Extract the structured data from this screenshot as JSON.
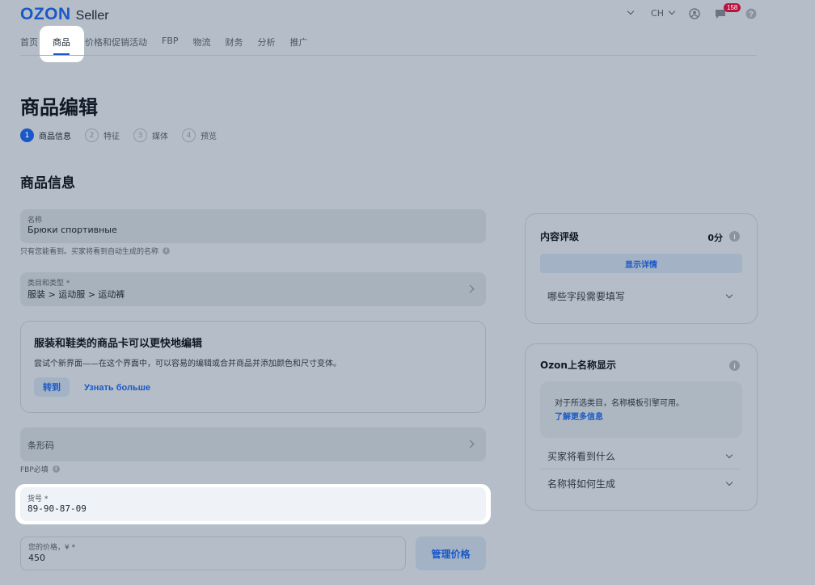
{
  "header": {
    "logo_brand": "OZON",
    "logo_product": "Seller",
    "language": "CH",
    "notifications_count": "158"
  },
  "nav": {
    "items": [
      "首页",
      "商品",
      "价格和促销活动",
      "FBP",
      "物流",
      "财务",
      "分析",
      "推广"
    ],
    "active_index": 1
  },
  "page": {
    "title": "商品编辑",
    "steps": [
      {
        "num": "1",
        "label": "商品信息"
      },
      {
        "num": "2",
        "label": "特征"
      },
      {
        "num": "3",
        "label": "媒体"
      },
      {
        "num": "4",
        "label": "预览"
      }
    ],
    "section_title": "商品信息"
  },
  "form": {
    "name": {
      "label": "名称",
      "value": "Брюки спортивные",
      "hint": "只有您能看到。买家将看到自动生成的名称"
    },
    "category": {
      "label": "类目和类型 *",
      "value": "服装 > 运动服 > 运动裤"
    },
    "promo": {
      "title": "服装和鞋类的商品卡可以更快地编辑",
      "text": "尝试个新界面——在这个界面中，可以容易的编辑或合并商品并添加颜色和尺寸变体。",
      "go_label": "转到",
      "more_label": "Узнать больше"
    },
    "barcode": {
      "label": "条形码",
      "hint": "FBP必填"
    },
    "sku": {
      "label": "货号 *",
      "value": "89-90-87-09"
    },
    "price": {
      "label": "您的价格，¥ *",
      "value": "450",
      "button_label": "管理价格"
    }
  },
  "sidebar": {
    "rating": {
      "title": "内容评级",
      "score": "0分",
      "details_label": "显示详情",
      "accordion_label": "哪些字段需要填写"
    },
    "naming": {
      "title": "Ozon上名称显示",
      "note_text": "对于所选类目，名称模板引擎可用。",
      "note_link": "了解更多信息",
      "acc1": "买家将看到什么",
      "acc2": "名称将如何生成"
    }
  }
}
